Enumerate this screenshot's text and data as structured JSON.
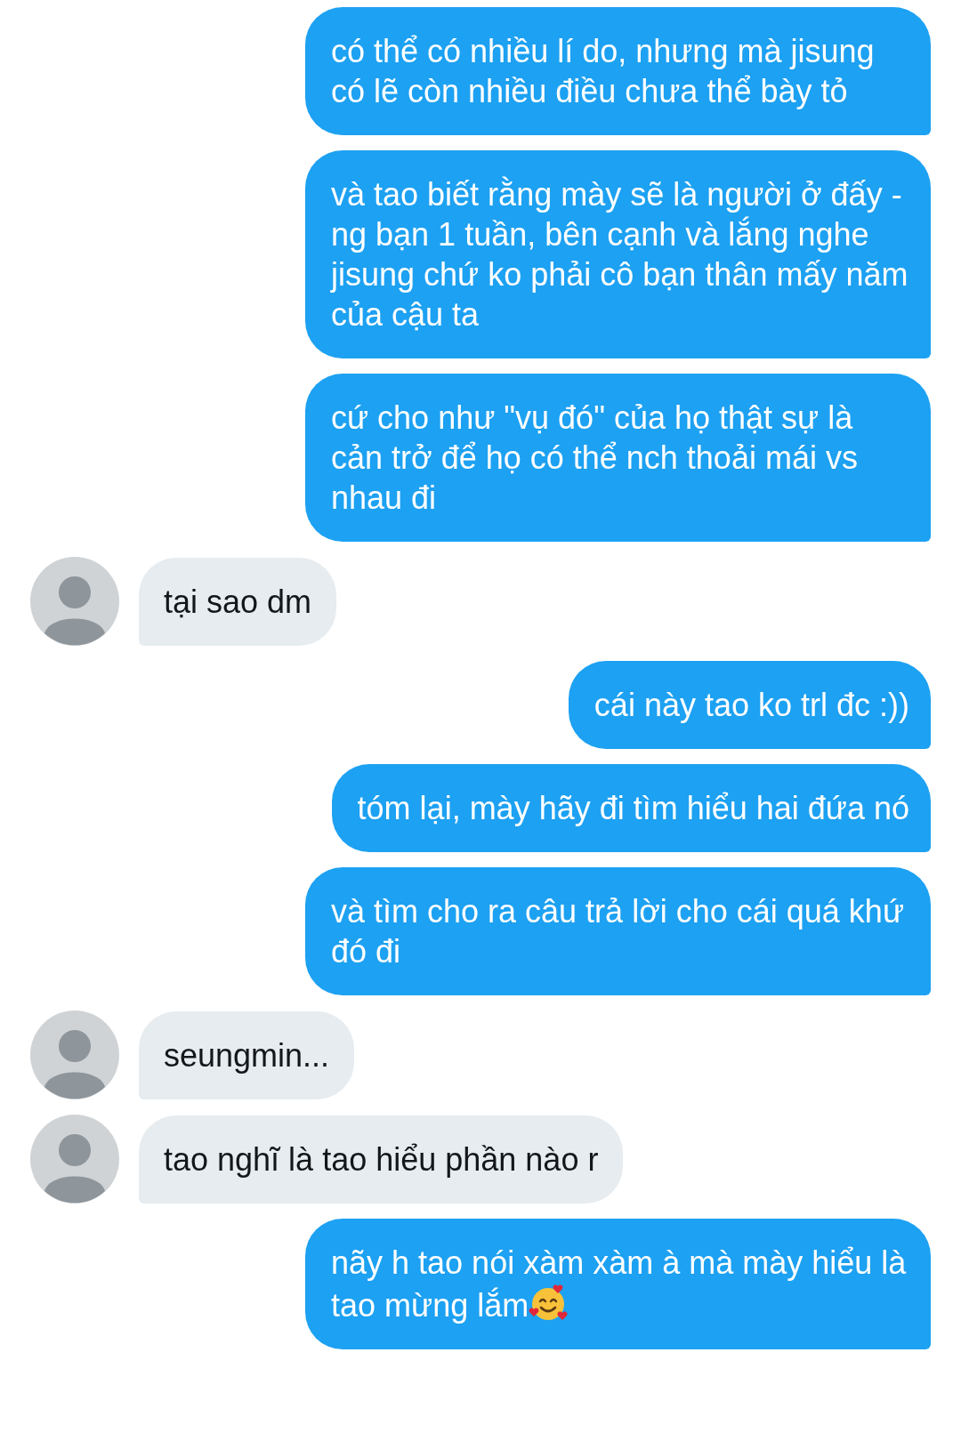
{
  "messages": [
    {
      "kind": "sent",
      "text": "có thể có nhiều lí do, nhưng mà jisung có lẽ còn nhiều điều chưa thể bày tỏ"
    },
    {
      "kind": "sent",
      "text": "và tao biết rằng mày sẽ là người ở đấy - ng bạn 1 tuần, bên cạnh và lắng nghe jisung chứ ko phải cô bạn thân mấy năm của cậu ta"
    },
    {
      "kind": "sent",
      "text": "cứ cho như \"vụ đó\" của họ thật sự là cản trở để họ có thể nch thoải mái vs nhau đi"
    },
    {
      "kind": "received",
      "text": "tại sao dm"
    },
    {
      "kind": "sent",
      "text": "cái này tao ko trl đc :))"
    },
    {
      "kind": "sent",
      "text": "tóm lại, mày hãy đi tìm hiểu hai đứa nó"
    },
    {
      "kind": "sent",
      "text": "và tìm cho ra câu trả lời cho cái quá khứ đó đi"
    },
    {
      "kind": "received",
      "text": "seungmin..."
    },
    {
      "kind": "received",
      "text": "tao nghĩ là tao hiểu phần nào r"
    },
    {
      "kind": "sent",
      "text": "nãy h tao nói xàm xàm à mà mày hiểu là tao mừng lắm",
      "trailing_emoji": true
    }
  ]
}
